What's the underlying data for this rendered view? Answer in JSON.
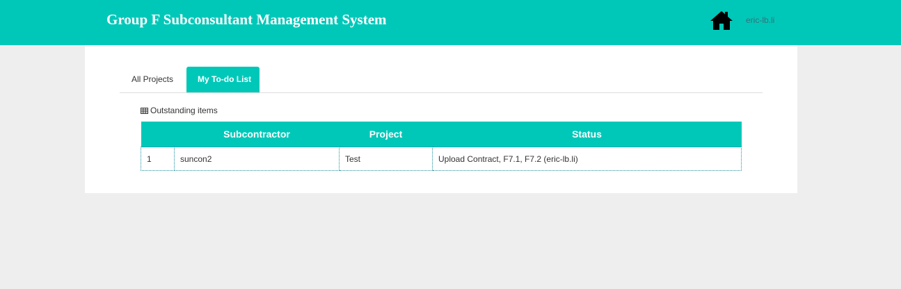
{
  "header": {
    "title": "Group F Subconsultant Management System",
    "home_icon": "home-icon",
    "user": "eric-lb.li",
    "color": "#00c8b9"
  },
  "tabs": [
    {
      "label": "All Projects",
      "active": false
    },
    {
      "label": "My To-do List",
      "active": true
    }
  ],
  "outstanding": {
    "title": "Outstanding items",
    "icon": "table-grid-icon",
    "columns": [
      "",
      "Subcontractor",
      "Project",
      "Status"
    ],
    "rows": [
      {
        "num": "1",
        "subcontractor": "suncon2",
        "project": "Test",
        "status": "Upload Contract, F7.1, F7.2 (eric-lb.li)"
      }
    ]
  }
}
